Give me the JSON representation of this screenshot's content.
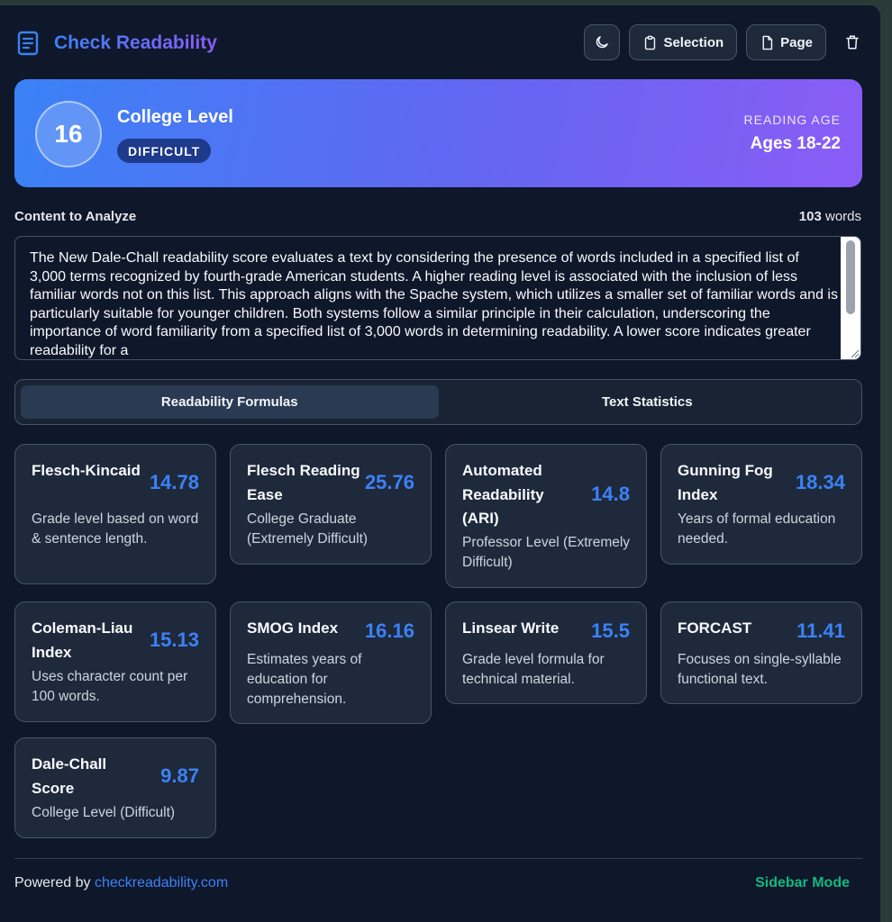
{
  "header": {
    "title": "Check Readability",
    "brand_icon": "document-icon",
    "buttons": [
      {
        "icon": "moon-icon",
        "label": ""
      },
      {
        "icon": "clipboard-icon",
        "label": "Selection"
      },
      {
        "icon": "file-icon",
        "label": "Page"
      },
      {
        "icon": "trash-icon",
        "label": ""
      }
    ]
  },
  "summary": {
    "grade": "16",
    "level": "College Level",
    "difficulty": "DIFFICULT",
    "reading_age_label": "READING AGE",
    "reading_age": "Ages 18-22"
  },
  "content": {
    "label": "Content to Analyze",
    "word_count": "103",
    "word_unit": " words",
    "text": "The New Dale-Chall readability score evaluates a text by considering the presence of words included in a specified list of 3,000 terms recognized by fourth-grade American students. A higher reading level is associated with the inclusion of less familiar words not on this list. This approach aligns with the Spache system, which utilizes a smaller set of familiar words and is particularly suitable for younger children. Both systems follow a similar principle in their calculation, underscoring the importance of word familiarity from a specified list of 3,000 words in determining readability. A lower score indicates greater readability for a"
  },
  "tabs": [
    {
      "label": "Readability Formulas",
      "active": true
    },
    {
      "label": "Text Statistics",
      "active": false
    }
  ],
  "formulas": [
    {
      "name": "Flesch-Kincaid",
      "score": "14.78",
      "description": "Grade level based on word & sentence length."
    },
    {
      "name": "Flesch Reading Ease",
      "score": "25.76",
      "description": "College Graduate (Extremely Difficult)"
    },
    {
      "name": "Automated Readability (ARI)",
      "score": "14.8",
      "description": "Professor Level (Extremely Difficult)"
    },
    {
      "name": "Gunning Fog Index",
      "score": "18.34",
      "description": "Years of formal education needed."
    },
    {
      "name": "Coleman-Liau Index",
      "score": "15.13",
      "description": "Uses character count per 100 words."
    },
    {
      "name": "SMOG Index",
      "score": "16.16",
      "description": "Estimates years of education for comprehension."
    },
    {
      "name": "Linsear Write",
      "score": "15.5",
      "description": "Grade level formula for technical material."
    },
    {
      "name": "FORCAST",
      "score": "11.41",
      "description": "Focuses on single-syllable functional text."
    },
    {
      "name": "Dale-Chall Score",
      "score": "9.87",
      "description": "College Level (Difficult)"
    }
  ],
  "footer": {
    "powered_prefix": "Powered by ",
    "powered_link": "checkreadability.com",
    "mode": "Sidebar Mode"
  },
  "colors": {
    "accent_blue": "#3b82f6",
    "accent_purple": "#8b5cf6",
    "score": "#3b82f6",
    "mode_green": "#10b981",
    "background": "#0f172a"
  }
}
